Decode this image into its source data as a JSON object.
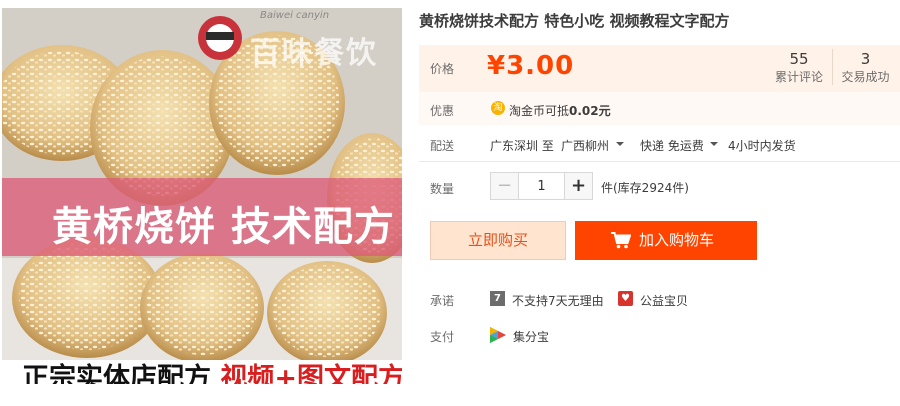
{
  "product": {
    "title": "黄桥烧饼技术配方 特色小吃 视频教程文字配方",
    "image": {
      "banner_text": "黄桥烧饼 技术配方",
      "bottom_text_black": "正宗实体店配方",
      "bottom_text_red": "视频+图文配方",
      "watermark": "百味餐饮",
      "watermark_small": "Baiwei canyin"
    }
  },
  "price": {
    "label": "价格",
    "value": "¥3.00",
    "reviews_count": "55",
    "reviews_label": "累计评论",
    "trades_count": "3",
    "trades_label": "交易成功"
  },
  "discount": {
    "label": "优惠",
    "icon": "淘",
    "text_prefix": "淘金币可抵",
    "amount": "0.02元"
  },
  "shipping": {
    "label": "配送",
    "origin": "广东深圳 至",
    "destination": "广西柳州",
    "method": "快递 免运费",
    "dispatch": "4小时内发货"
  },
  "quantity": {
    "label": "数量",
    "value": "1",
    "minus": "−",
    "plus": "+",
    "stock": "件(库存2924件)"
  },
  "actions": {
    "buy_now": "立即购买",
    "add_to_cart": "加入购物车"
  },
  "promise": {
    "label": "承诺",
    "no_return_icon": "7",
    "no_return_text": "不支持7天无理由",
    "charity_text": "公益宝贝"
  },
  "payment": {
    "label": "支付",
    "method": "集分宝"
  },
  "colors": {
    "accent": "#ff4400",
    "price": "#ff4400",
    "price_bg": "#fff2e8"
  }
}
